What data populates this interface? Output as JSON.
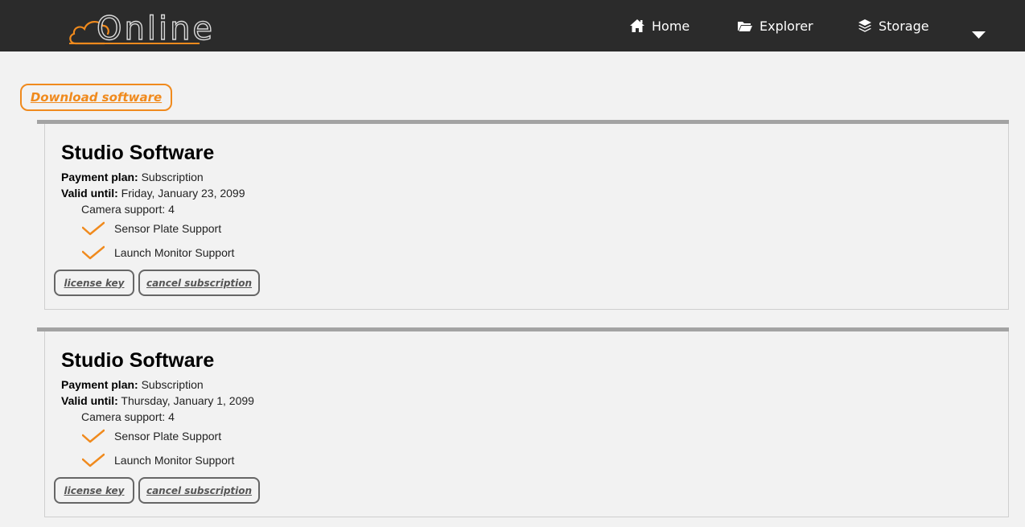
{
  "header": {
    "logo_text": "Online",
    "nav": {
      "home": "Home",
      "explorer": "Explorer",
      "storage": "Storage"
    }
  },
  "download_label": "Download software",
  "colors": {
    "accent": "#f08a1d",
    "topbar": "#2b2b2b",
    "background": "#f2f2f2"
  },
  "subscriptions": [
    {
      "title": "Studio Software",
      "payment_label": "Payment plan:",
      "payment_value": "Subscription",
      "valid_label": "Valid until:",
      "valid_value": "Friday, January 23, 2099",
      "camera_support": "Camera support: 4",
      "features": [
        "Sensor Plate Support",
        "Launch Monitor Support"
      ],
      "license_label": "license key",
      "cancel_label": "cancel subscription"
    },
    {
      "title": "Studio Software",
      "payment_label": "Payment plan:",
      "payment_value": "Subscription",
      "valid_label": "Valid until:",
      "valid_value": "Thursday, January 1, 2099",
      "camera_support": "Camera support: 4",
      "features": [
        "Sensor Plate Support",
        "Launch Monitor Support"
      ],
      "license_label": "license key",
      "cancel_label": "cancel subscription"
    }
  ]
}
